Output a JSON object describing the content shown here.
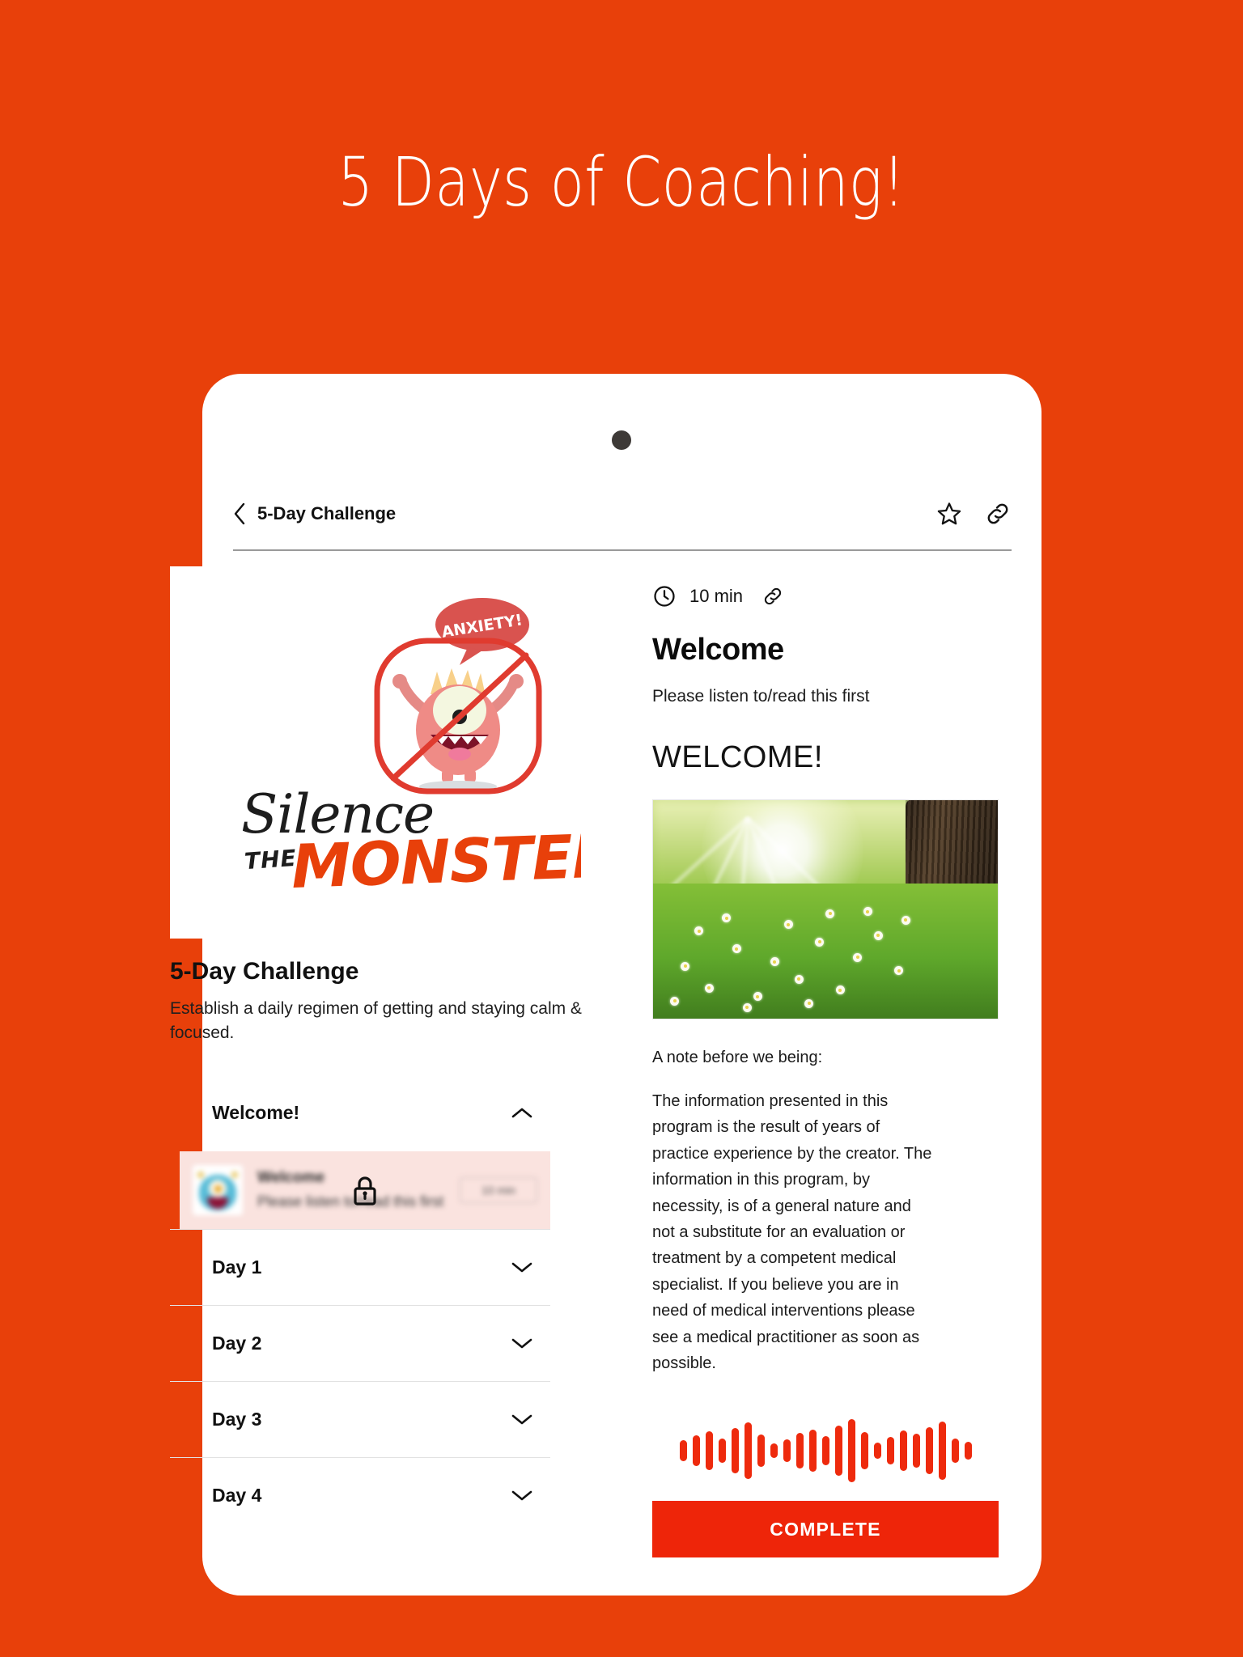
{
  "promo": {
    "headline": "5 Days of Coaching!"
  },
  "colors": {
    "background_orange": "#e8400a",
    "accent_red": "#ee2509",
    "locked_row_pink": "#fae3df",
    "camera_dot": "#3e3a37"
  },
  "app_header": {
    "back_icon": "chevron-left-icon",
    "title": "5-Day Challenge",
    "favorite_icon": "star-icon",
    "share_icon": "link-icon"
  },
  "course": {
    "hero_logo": {
      "word_top": "Silence",
      "word_the": "THE",
      "word_bottom": "MONSTER",
      "bubble_text": "ANXIETY!",
      "mascot": "monster-icon"
    },
    "title": "5-Day Challenge",
    "description": "Establish a daily regimen of getting and staying calm & focused.",
    "sections": [
      {
        "label": "Welcome!",
        "expanded": true,
        "chevron": "chevron-up-icon"
      },
      {
        "label": "Day 1",
        "expanded": false,
        "chevron": "chevron-down-icon"
      },
      {
        "label": "Day 2",
        "expanded": false,
        "chevron": "chevron-down-icon"
      },
      {
        "label": "Day 3",
        "expanded": false,
        "chevron": "chevron-down-icon"
      },
      {
        "label": "Day 4",
        "expanded": false,
        "chevron": "chevron-down-icon"
      }
    ],
    "locked_lesson": {
      "thumbnail": "monster-thumbnail",
      "name": "Welcome",
      "subtitle": "Please listen to/read this first",
      "duration": "10 min",
      "lock_icon": "lock-icon",
      "locked": true
    }
  },
  "lesson": {
    "duration_icon": "clock-icon",
    "duration": "10 min",
    "share_icon": "link-icon",
    "title": "Welcome",
    "subtitle": "Please listen to/read this first",
    "heading": "WELCOME!",
    "image_alt": "sunlit-meadow-photo",
    "note_lead": "A note before we being:",
    "note_body": "The information presented in this program is the result of years of practice experience by the creator. The information in this program, by necessity, is of a general nature and not a substitute for an evaluation or treatment by a competent medical specialist. If you believe you are in need of medical interventions please see a medical practitioner as soon as possible.",
    "audio_waveform": "audio-waveform",
    "waveform_heights": [
      26,
      38,
      48,
      30,
      56,
      70,
      40,
      18,
      28,
      44,
      52,
      36,
      62,
      78,
      46,
      20,
      34,
      50,
      42,
      58,
      72,
      30,
      22
    ],
    "complete_label": "COMPLETE"
  }
}
